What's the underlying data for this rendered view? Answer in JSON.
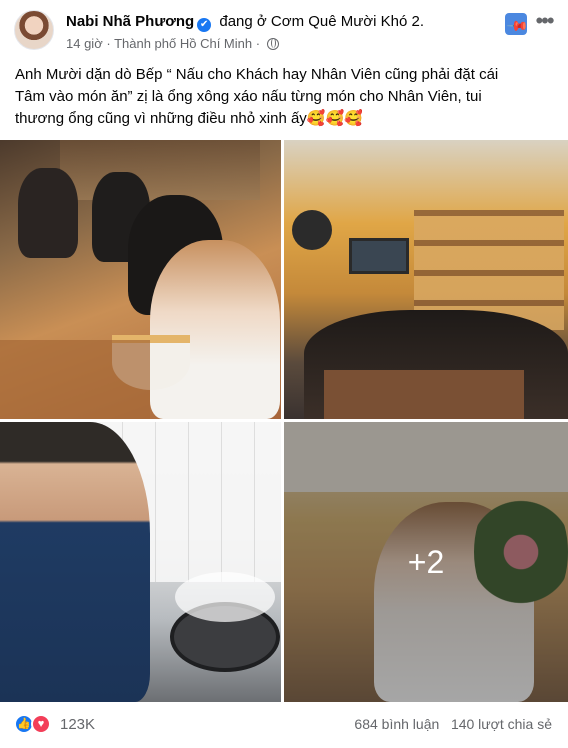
{
  "post": {
    "author": "Nabi Nhã Phương",
    "checkin_prefix": "đang ở Cơm Quê Mười Khó 2.",
    "time": "14 giờ",
    "separator": "·",
    "location": "Thành phố Hồ Chí Minh",
    "text_line1": "Anh Mười dặn dò Bếp “ Nấu cho Khách hay Nhân Viên cũng phải đặt cái",
    "text_line2": "Tâm vào món ăn” zị là ổng xông xáo nấu từng món cho Nhân Viên, tui",
    "text_line3": "thương ổng cũng vì những điều nhỏ xinh ấy",
    "text_emoji": "🥰🥰🥰",
    "verified_mark": "✔"
  },
  "photos": {
    "more_count": "+2"
  },
  "icons": {
    "pin": "pin-icon",
    "more": "more-options-icon",
    "globe": "globe-icon",
    "like": "like-icon",
    "love": "love-icon",
    "like_glyph": "👍",
    "love_glyph": "♥",
    "pin_glyph": "📌",
    "more_glyph": "•••"
  },
  "footer": {
    "reaction_count": "123K",
    "comments": "684 bình luận",
    "shares": "140 lượt chia sẻ"
  },
  "colors": {
    "accent": "#1877f2",
    "love": "#f33e58",
    "pin_bg": "#4b88e0",
    "muted_text": "#65676b"
  }
}
